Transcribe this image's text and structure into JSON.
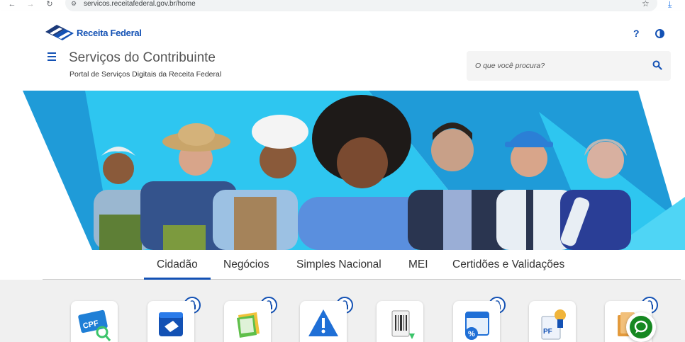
{
  "browser": {
    "url": "servicos.receitafederal.gov.br/home",
    "back_icon": "arrow-left-icon",
    "forward_icon": "arrow-right-icon",
    "reload_icon": "reload-icon",
    "bookmark_icon": "star-icon",
    "download_icon": "download-icon"
  },
  "header": {
    "logo_text": "Receita Federal",
    "title": "Serviços do Contribuinte",
    "subtitle": "Portal de Serviços Digitais da Receita Federal",
    "search_placeholder": "O que você procura?",
    "help_label": "?"
  },
  "tabs": [
    {
      "label": "Cidadão",
      "active": true
    },
    {
      "label": "Negócios",
      "active": false
    },
    {
      "label": "Simples Nacional",
      "active": false
    },
    {
      "label": "MEI",
      "active": false
    },
    {
      "label": "Certidões e Validações",
      "active": false
    }
  ],
  "service_cards": [
    {
      "icon": "cpf-card-icon",
      "locked": false
    },
    {
      "icon": "wallet-icon",
      "locked": true
    },
    {
      "icon": "document-stack-icon",
      "locked": true
    },
    {
      "icon": "warning-icon",
      "locked": true
    },
    {
      "icon": "darf-barcode-icon",
      "locked": true
    },
    {
      "icon": "calendar-percent-icon",
      "locked": true
    },
    {
      "icon": "pf-badge-icon",
      "locked": false
    },
    {
      "icon": "folder-icon",
      "locked": true
    }
  ],
  "colors": {
    "brand_blue": "#1351b4",
    "hero_cyan": "#2ec6f0",
    "chat_green": "#168821"
  }
}
